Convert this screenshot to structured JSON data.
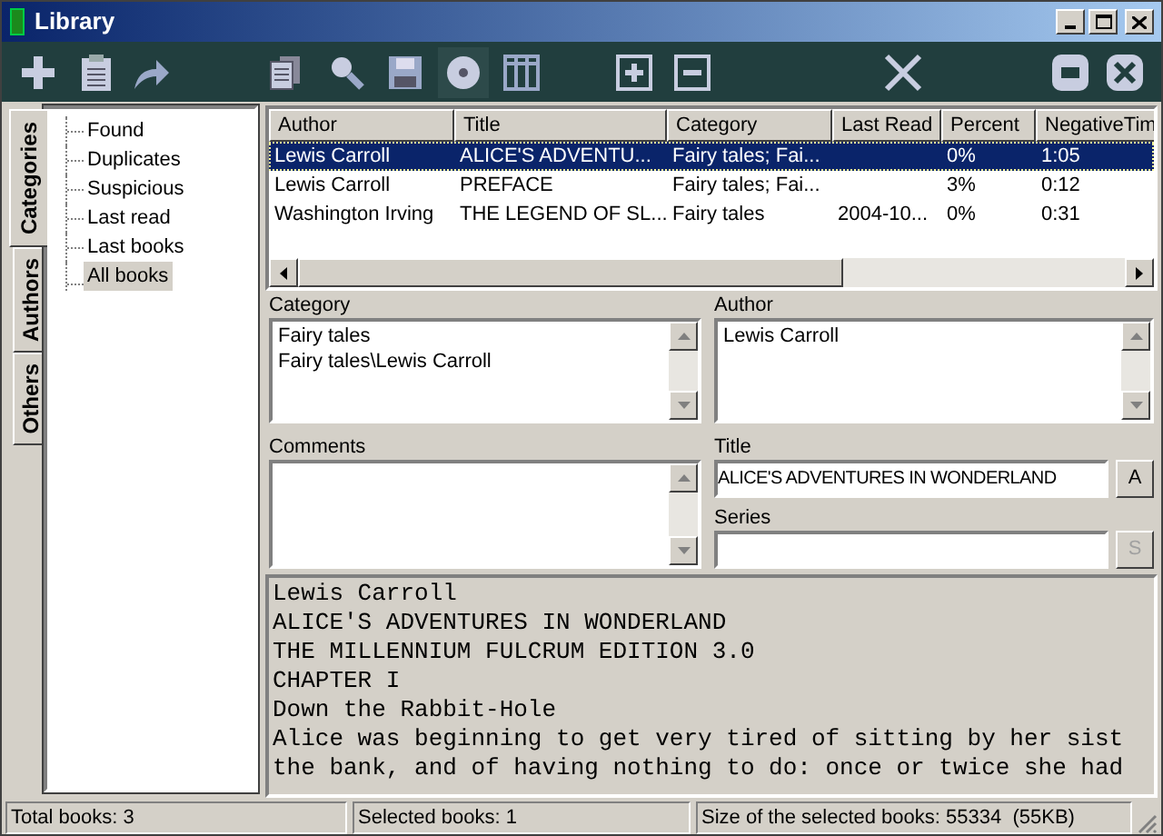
{
  "window": {
    "title": "Library"
  },
  "side_tabs": [
    {
      "label": "Categories",
      "selected": true
    },
    {
      "label": "Authors",
      "selected": false
    },
    {
      "label": "Others",
      "selected": false
    }
  ],
  "tree": {
    "items": [
      {
        "label": "Found",
        "selected": false
      },
      {
        "label": "Duplicates",
        "selected": false
      },
      {
        "label": "Suspicious",
        "selected": false
      },
      {
        "label": "Last read",
        "selected": false
      },
      {
        "label": "Last books",
        "selected": false
      },
      {
        "label": "All books",
        "selected": true
      }
    ]
  },
  "table": {
    "columns": [
      "Author",
      "Title",
      "Category",
      "Last Read",
      "Percent",
      "NegativeTim"
    ],
    "rows": [
      {
        "selected": true,
        "cells": [
          "Lewis Carroll",
          "ALICE'S ADVENTU...",
          "Fairy tales; Fai...",
          "",
          "0%",
          "1:05"
        ]
      },
      {
        "selected": false,
        "cells": [
          "Lewis Carroll",
          "PREFACE",
          "Fairy tales; Fai...",
          "",
          "3%",
          "0:12"
        ]
      },
      {
        "selected": false,
        "cells": [
          "Washington Irving",
          "THE LEGEND OF SL...",
          "Fairy tales",
          "2004-10...",
          "0%",
          "0:31"
        ]
      }
    ]
  },
  "details": {
    "category": {
      "label": "Category",
      "lines": [
        "Fairy tales",
        "Fairy tales\\Lewis Carroll"
      ]
    },
    "author": {
      "label": "Author",
      "lines": [
        "Lewis Carroll"
      ]
    },
    "comments": {
      "label": "Comments"
    },
    "title": {
      "label": "Title",
      "value": "ALICE'S ADVENTURES IN WONDERLAND",
      "button": "A",
      "button_disabled": false
    },
    "series": {
      "label": "Series",
      "button": "S",
      "button_disabled": true
    }
  },
  "preview": [
    "Lewis Carroll",
    "ALICE'S ADVENTURES IN WONDERLAND",
    "THE MILLENNIUM FULCRUM EDITION 3.0",
    "CHAPTER I",
    "Down the Rabbit-Hole",
    "Alice was beginning to get very tired of sitting by her sist",
    "the bank, and of having nothing to do: once or twice she had"
  ],
  "status_bar": [
    "Total books: 3",
    "Selected books: 1",
    "Size of the selected books: 55334  (55KB)"
  ]
}
